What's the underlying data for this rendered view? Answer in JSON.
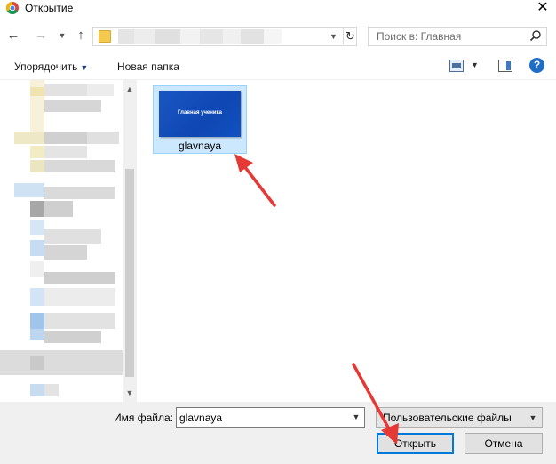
{
  "window": {
    "title": "Открытие",
    "close_glyph": "✕"
  },
  "nav": {
    "back_glyph": "←",
    "forward_glyph": "→",
    "dropdown_glyph": "▼",
    "up_glyph": "↑",
    "refresh_glyph": "↻",
    "search_placeholder": "Поиск в: Главная"
  },
  "toolbar": {
    "organize_label": "Упорядочить",
    "organize_caret": "▼",
    "new_folder_label": "Новая папка",
    "view_caret": "▼",
    "help_label": "?"
  },
  "files": [
    {
      "name": "glavnaya",
      "thumbnail_caption": "Главная ученика",
      "selected": true
    }
  ],
  "bottom": {
    "filename_label": "Имя файла:",
    "filename_value": "glavnaya",
    "file_type_value": "Пользовательские файлы",
    "open_label": "Открыть",
    "cancel_label": "Отмена"
  },
  "colors": {
    "selection": "#cce8ff",
    "accent": "#0078d7",
    "arrow": "#e53935",
    "thumbnail": "#1a57c4"
  }
}
